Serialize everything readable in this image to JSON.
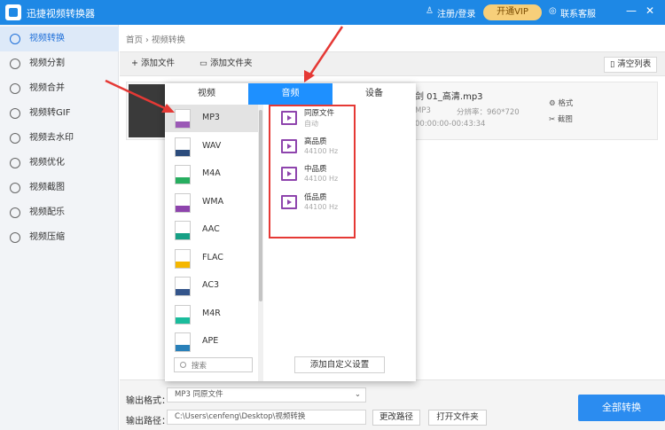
{
  "app": {
    "title": "迅捷视频转换器"
  },
  "titlebar": {
    "login": "注册/登录",
    "vip": "开通VIP",
    "support": "联系客服",
    "minimize": "—",
    "close": "✕"
  },
  "sidebar": {
    "items": [
      {
        "label": "视频转换"
      },
      {
        "label": "视频分割"
      },
      {
        "label": "视频合并"
      },
      {
        "label": "视频转GIF"
      },
      {
        "label": "视频去水印"
      },
      {
        "label": "视频优化"
      },
      {
        "label": "视频截图"
      },
      {
        "label": "视频配乐"
      },
      {
        "label": "视频压缩"
      }
    ]
  },
  "breadcrumb": "首页 › 视频转换",
  "toolbar": {
    "add_file": "+ 添加文件",
    "add_folder": "添加文件夹",
    "clear_list": "清空列表"
  },
  "file": {
    "name": "剑 01_高清.mp3",
    "format": "MP3",
    "resolution": "分辨率：960*720",
    "duration": "00:00:00-00:43:34",
    "action_format": "格式",
    "action_cut": "截图"
  },
  "popup": {
    "tabs": [
      "视频",
      "音频",
      "设备"
    ],
    "formats": [
      {
        "label": "MP3",
        "color": "#9b59b6"
      },
      {
        "label": "WAV",
        "color": "#2c4c7c"
      },
      {
        "label": "M4A",
        "color": "#27ae60"
      },
      {
        "label": "WMA",
        "color": "#8e44ad"
      },
      {
        "label": "AAC",
        "color": "#16a085"
      },
      {
        "label": "FLAC",
        "color": "#f5b700"
      },
      {
        "label": "AC3",
        "color": "#34558b"
      },
      {
        "label": "M4R",
        "color": "#1abc9c"
      },
      {
        "label": "APE",
        "color": "#2980b9"
      }
    ],
    "qualities": [
      {
        "name": "同原文件",
        "sub": "自动"
      },
      {
        "name": "高品质",
        "sub": "44100 Hz"
      },
      {
        "name": "中品质",
        "sub": "44100 Hz"
      },
      {
        "name": "低品质",
        "sub": "44100 Hz"
      }
    ],
    "search_placeholder": "搜索",
    "custom": "添加自定义设置"
  },
  "bottom": {
    "format_label": "输出格式：",
    "format_value": "MP3  同原文件",
    "path_label": "输出路径：",
    "path_value": "C:\\Users\\cenfeng\\Desktop\\视频转换",
    "change_path": "更改路径",
    "open_folder": "打开文件夹",
    "convert_all": "全部转换"
  },
  "colors": {
    "accent": "#1e90ff",
    "highlight": "#e53935",
    "quality_icon": "#8e44ad"
  }
}
